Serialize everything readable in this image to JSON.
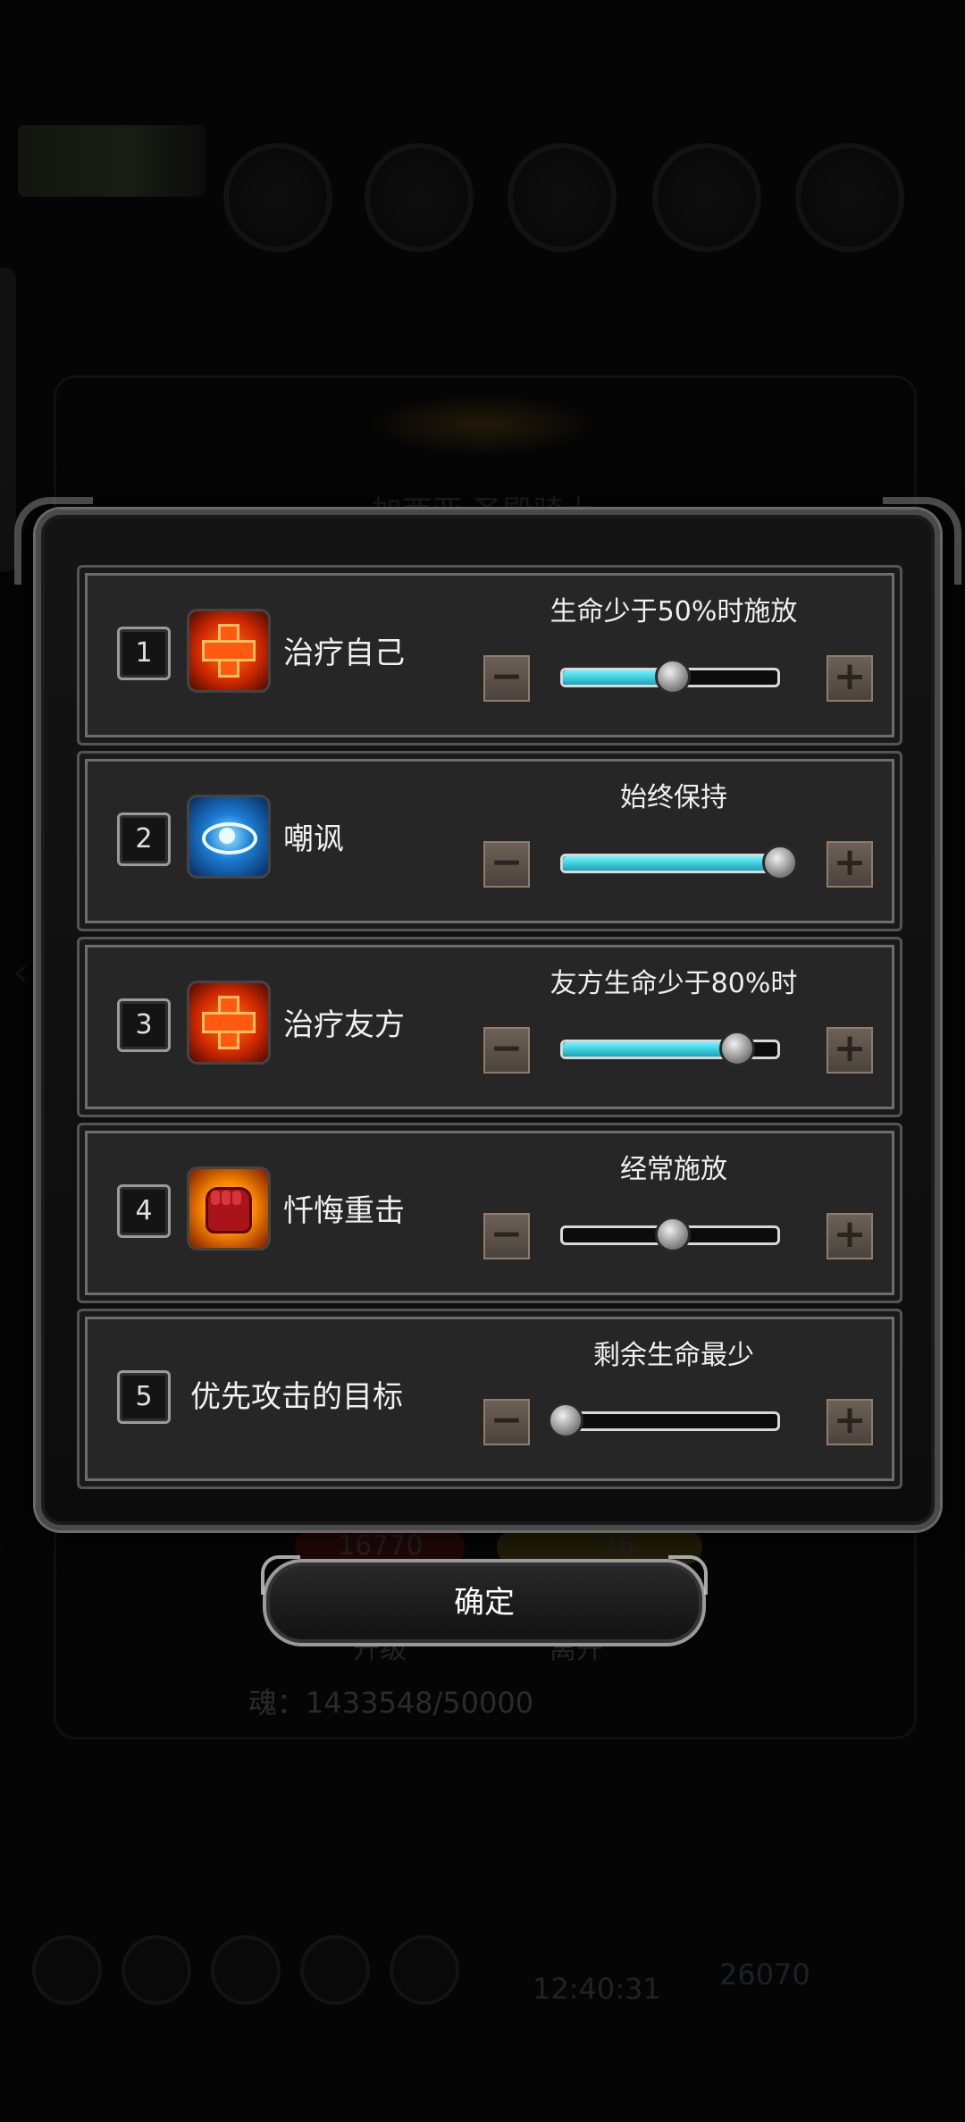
{
  "background": {
    "character_name": "加西亚·圣殿骑士",
    "hp_value": "16770",
    "energy_value": "36",
    "button_upgrade": "升级",
    "button_leave": "离开",
    "soul_text": "魂：1433548/50000",
    "clock": "12:40:31",
    "currency": "26070"
  },
  "dialog": {
    "rows": [
      {
        "index": "1",
        "icon": "heal-cross-icon",
        "name": "治疗自己",
        "condition": "生命少于50%时施放",
        "slider_fraction": 0.5
      },
      {
        "index": "2",
        "icon": "eye-taunt-icon",
        "name": "嘲讽",
        "condition": "始终保持",
        "slider_fraction": 1.0
      },
      {
        "index": "3",
        "icon": "heal-cross-icon",
        "name": "治疗友方",
        "condition": "友方生命少于80%时",
        "slider_fraction": 0.8
      },
      {
        "index": "4",
        "icon": "fist-strike-icon",
        "name": "忏悔重击",
        "condition": "经常施放",
        "slider_fraction": 0.5
      },
      {
        "index": "5",
        "icon": "",
        "name": "优先攻击的目标",
        "condition": "剩余生命最少",
        "slider_fraction": 0.0
      }
    ],
    "minus_label": "−",
    "plus_label": "+",
    "confirm_label": "确定"
  },
  "colors": {
    "slider_fill": "#1aa6b8",
    "stepper": "#5b5148",
    "frame": "#555555"
  }
}
